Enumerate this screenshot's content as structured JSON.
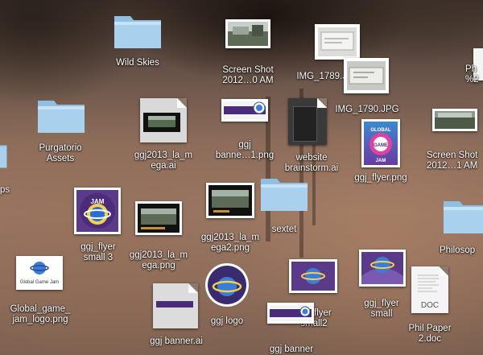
{
  "colors": {
    "folder_top": "#a9d0ec",
    "folder_body": "#7eb3dc",
    "purple": "#4b2c7a",
    "doc_gray": "#e9e9e9"
  },
  "icons": {
    "wild_skies": {
      "label": "Wild Skies"
    },
    "screenshot_1": {
      "label_line1": "Screen Shot",
      "label_line2": "2012…0 AM"
    },
    "img_1789": {
      "label": "IMG_1789.JPG"
    },
    "img_1790": {
      "label": "IMG_1790.JPG"
    },
    "ph_partial": {
      "label_line1": "Ph",
      "label_line2": "%2"
    },
    "purgatorio": {
      "label_line1": "Purgatorio",
      "label_line2": "Assets"
    },
    "ggj2013_la_mega_ai": {
      "label_line1": "ggj2013_la_m",
      "label_line2": "ega.ai"
    },
    "ggj_banner_1": {
      "label_line1": "ggj",
      "label_line2": "banne…1.png"
    },
    "website_brainstorm": {
      "label_line1": "website",
      "label_line2": "brainstorm.ai"
    },
    "ggj_flyer_png": {
      "label": "ggj_flyer.png",
      "text_top": "GLOBAL",
      "text_mid": "GAME",
      "text_bot": "JAM"
    },
    "screenshot_2": {
      "label_line1": "Screen Shot",
      "label_line2": "2012…1 AM"
    },
    "ps_partial": {
      "label": "ps"
    },
    "ggj_flyer_small3": {
      "label_line1": "ggj_flyer",
      "label_line2": "small 3",
      "text_top": "JAM"
    },
    "ggj2013_la_mega_png": {
      "label_line1": "ggj2013_la_m",
      "label_line2": "ega.png"
    },
    "ggj2013_la_mega2": {
      "label_line1": "ggj2013_la_m",
      "label_line2": "ega2.png"
    },
    "sextet": {
      "label": "sextet"
    },
    "philosop": {
      "label": "Philosop"
    },
    "global_game_jam_logo": {
      "label_line1": "Global_game_",
      "label_line2": "jam_logo.png",
      "logo_text": "Global Game Jam"
    },
    "ggj_banner_ai": {
      "label": "ggj banner.ai"
    },
    "ggj_logo": {
      "label": "ggj logo"
    },
    "ggj_flyer_small2": {
      "label_line1": "ggj_flyer",
      "label_line2": "small2"
    },
    "ggj_banner": {
      "label": "ggj banner"
    },
    "ggj_flyer_small": {
      "label_line1": "ggj_flyer",
      "label_line2": "small"
    },
    "phil_paper": {
      "label_line1": "Phil Paper",
      "label_line2": "2.doc",
      "doc_text": "DOC"
    }
  }
}
